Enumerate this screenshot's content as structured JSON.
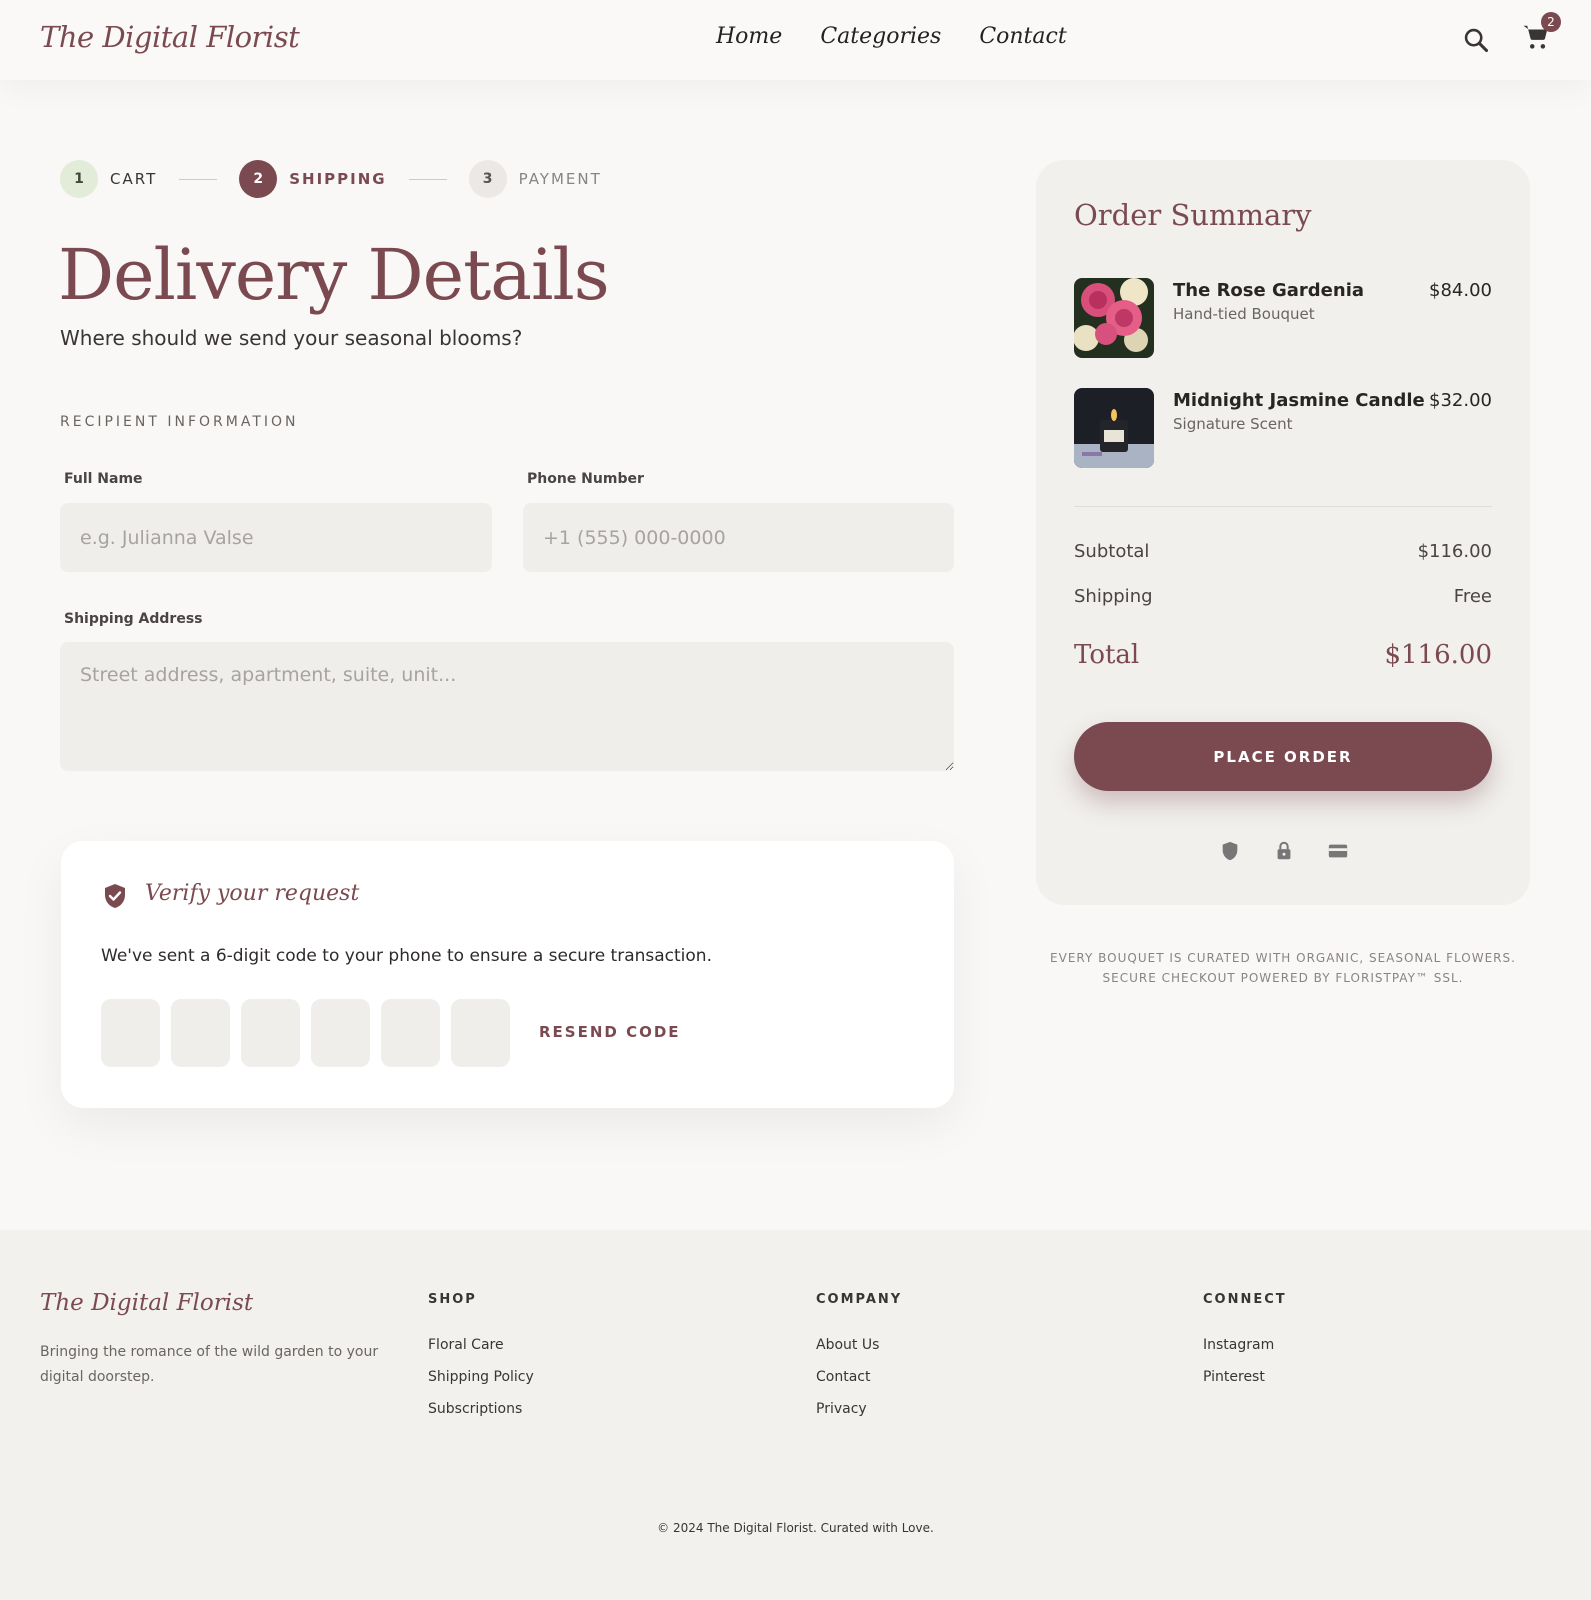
{
  "header": {
    "logo": "The Digital Florist",
    "nav": [
      "Home",
      "Categories",
      "Contact"
    ],
    "cart_count": "2"
  },
  "steps": [
    {
      "number": "1",
      "label": "CART"
    },
    {
      "number": "2",
      "label": "SHIPPING"
    },
    {
      "number": "3",
      "label": "PAYMENT"
    }
  ],
  "main": {
    "title": "Delivery Details",
    "subtitle": "Where should we send your seasonal blooms?",
    "section_label": "RECIPIENT INFORMATION",
    "full_name": {
      "label": "Full Name",
      "placeholder": "e.g. Julianna Valse"
    },
    "phone": {
      "label": "Phone Number",
      "placeholder": "+1 (555) 000-0000"
    },
    "address": {
      "label": "Shipping Address",
      "placeholder": "Street address, apartment, suite, unit..."
    }
  },
  "verify": {
    "title": "Verify your request",
    "text": "We've sent a 6-digit code to your phone to ensure a secure transaction.",
    "resend": "RESEND CODE"
  },
  "summary": {
    "title": "Order Summary",
    "items": [
      {
        "name": "The Rose Gardenia",
        "sub": "Hand-tied Bouquet",
        "price": "$84.00"
      },
      {
        "name": "Midnight Jasmine Candle",
        "sub": "Signature Scent",
        "price": "$32.00"
      }
    ],
    "subtotal_label": "Subtotal",
    "subtotal": "$116.00",
    "shipping_label": "Shipping",
    "shipping": "Free",
    "total_label": "Total",
    "total": "$116.00",
    "cta": "PLACE ORDER",
    "footnote_1": "EVERY BOUQUET IS CURATED WITH ORGANIC, SEASONAL FLOWERS.",
    "footnote_2": "SECURE CHECKOUT POWERED BY FLORISTPAY™ SSL."
  },
  "footer": {
    "logo": "The Digital Florist",
    "tagline": "Bringing the romance of the wild garden to your digital doorstep.",
    "shop": {
      "heading": "SHOP",
      "links": [
        "Floral Care",
        "Shipping Policy",
        "Subscriptions"
      ]
    },
    "company": {
      "heading": "COMPANY",
      "links": [
        "About Us",
        "Contact",
        "Privacy"
      ]
    },
    "connect": {
      "heading": "CONNECT",
      "links": [
        "Instagram",
        "Pinterest"
      ]
    },
    "copyright": "© 2024 The Digital Florist. Curated with Love."
  },
  "colors": {
    "accent": "#7a4a50",
    "background": "#f9f8f6",
    "field": "#efeeea"
  }
}
